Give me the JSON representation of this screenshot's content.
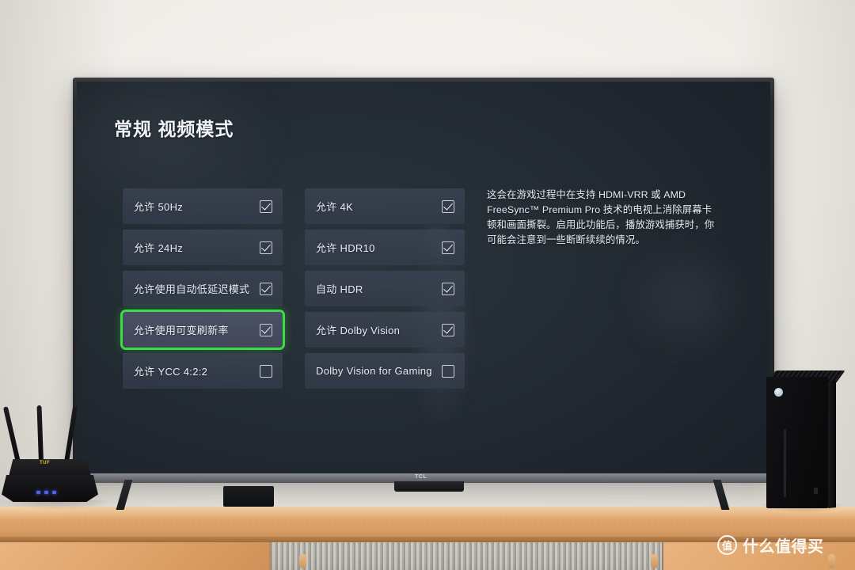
{
  "screen": {
    "title": "常规 视频模式",
    "options_left": [
      {
        "label": "允许 50Hz",
        "checked": true,
        "selected": false
      },
      {
        "label": "允许 24Hz",
        "checked": true,
        "selected": false
      },
      {
        "label": "允许使用自动低延迟模式",
        "checked": true,
        "selected": false
      },
      {
        "label": "允许使用可变刷新率",
        "checked": true,
        "selected": true
      },
      {
        "label": "允许 YCC 4:2:2",
        "checked": false,
        "selected": false
      }
    ],
    "options_right": [
      {
        "label": "允许 4K",
        "checked": true,
        "selected": false
      },
      {
        "label": "允许 HDR10",
        "checked": true,
        "selected": false
      },
      {
        "label": "自动 HDR",
        "checked": true,
        "selected": false
      },
      {
        "label": "允许 Dolby Vision",
        "checked": true,
        "selected": false
      },
      {
        "label": "Dolby Vision for Gaming",
        "checked": false,
        "selected": false
      }
    ],
    "description": "这会在游戏过程中在支持 HDMI-VRR 或 AMD FreeSync™ Premium Pro 技术的电视上消除屏幕卡顿和画面撕裂。启用此功能后，播放游戏捕获时，你可能会注意到一些断断续续的情况。"
  },
  "tv": {
    "brand_logo": "TCL"
  },
  "devices": {
    "router_brand": "TUF"
  },
  "watermark": {
    "badge": "值",
    "text": "什么值得买"
  },
  "colors": {
    "selection_green": "#3bdc45",
    "screen_bg": "#232b33",
    "row_bg": "#3c4454",
    "wall": "#f2f0ec",
    "wood": "#dfa368",
    "text": "#eef1f5"
  }
}
